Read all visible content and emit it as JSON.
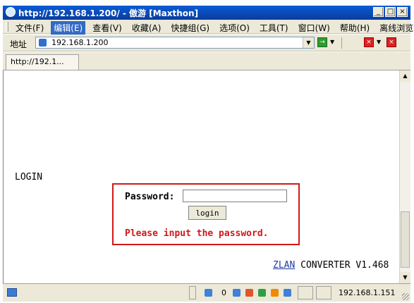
{
  "window": {
    "title": "http://192.168.1.200/ - 傲游 [Maxthon]",
    "controls": {
      "minimize": "_",
      "maximize": "□",
      "close": "×"
    }
  },
  "menu": {
    "items": [
      {
        "label": "文件(F)"
      },
      {
        "label": "编辑(E)",
        "active": true
      },
      {
        "label": "查看(V)"
      },
      {
        "label": "收藏(A)"
      },
      {
        "label": "快捷组(G)"
      },
      {
        "label": "选项(O)"
      },
      {
        "label": "工具(T)"
      },
      {
        "label": "窗口(W)"
      },
      {
        "label": "帮助(H)"
      },
      {
        "label": "离线浏览"
      }
    ]
  },
  "address": {
    "label": "地址",
    "value": "192.168.1.200",
    "icons": [
      "page-icon",
      "go-icon",
      "stop-icon",
      "close-tab-icon"
    ]
  },
  "tabs": [
    {
      "label": "http://192.1..."
    }
  ],
  "page": {
    "heading": "LOGIN",
    "password_label": "Password:",
    "password_value": "",
    "login_button": "login",
    "error_message": "Please input the password.",
    "footer_link": "ZLAN",
    "footer_text": " CONVERTER V1.468"
  },
  "status": {
    "count": "0",
    "ip": "192.168.1.151"
  },
  "colors": {
    "titlebar": "#0a4fc4",
    "error": "#d01818",
    "frame": "#d01818",
    "link": "#1a3aa8",
    "chrome": "#ece9d8"
  }
}
